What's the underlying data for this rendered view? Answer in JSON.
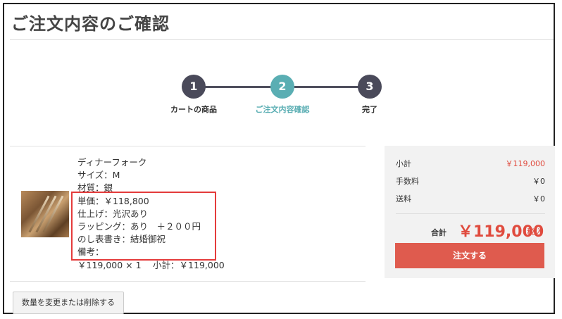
{
  "page": {
    "title": "ご注文内容のご確認"
  },
  "steps": [
    {
      "number": "1",
      "label": "カートの商品"
    },
    {
      "number": "2",
      "label": "ご注文内容確認"
    },
    {
      "number": "3",
      "label": "完了"
    }
  ],
  "item": {
    "name": "ディナーフォーク",
    "size": "サイズ：M",
    "material": "材質：銀",
    "unit_price": "単価：￥118,800",
    "finish": "仕上げ：光沢あり",
    "wrapping": "ラッピング：あり　＋２００円",
    "noshi": "のし表書き：結婚御祝",
    "remarks": "備考：",
    "line_total": "￥119,000 × 1　 小計：￥119,000"
  },
  "actions": {
    "change_label": "数量を変更または削除する"
  },
  "summary": {
    "subtotal_label": "小計",
    "subtotal_value": "￥119,000",
    "fee_label": "手数料",
    "fee_value": "￥0",
    "shipping_label": "送料",
    "shipping_value": "￥0",
    "total_label": "合計",
    "total_value": "￥119,000",
    "tax_label": "税込",
    "order_label": "注文する"
  },
  "colors": {
    "accent": "#5aaeb3",
    "step_dark": "#4a4a5a",
    "red": "#e04b3e",
    "highlight": "#e43b3b"
  }
}
